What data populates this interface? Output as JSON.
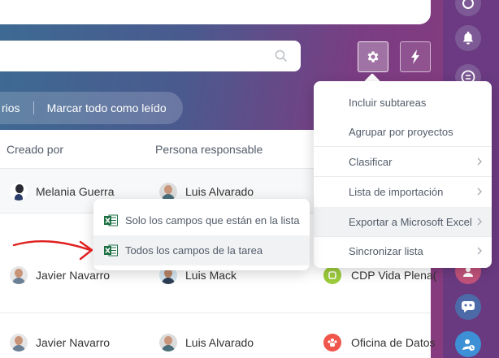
{
  "search": {
    "placeholder": ""
  },
  "toolbar": {
    "settings_icon": "gear-icon",
    "automation_icon": "lightning-icon"
  },
  "filters": {
    "left_fragment": "rios",
    "mark_all_read": "Marcar todo como leído"
  },
  "table": {
    "columns": [
      "Creado por",
      "Persona responsable"
    ],
    "rows": [
      {
        "created_by": "Melania Guerra",
        "responsible": "Luis Alvarado",
        "group": ""
      },
      {
        "created_by": "Javier Navarro",
        "responsible": "Luis Mack",
        "group": "CDP Vida Plena("
      },
      {
        "created_by": "Javier Navarro",
        "responsible": "Luis Alvarado",
        "group": "Oficina de Datos"
      }
    ]
  },
  "settings_menu": {
    "items": [
      {
        "label": "Incluir subtareas",
        "has_submenu": false
      },
      {
        "label": "Agrupar por proyectos",
        "has_submenu": false
      },
      {
        "label": "Clasificar",
        "has_submenu": true
      },
      {
        "label": "Lista de importación",
        "has_submenu": true
      },
      {
        "label": "Exportar a Microsoft Excel",
        "has_submenu": true
      },
      {
        "label": "Sincronizar lista",
        "has_submenu": true
      }
    ]
  },
  "export_submenu": {
    "items": [
      {
        "label": "Solo los campos que están en la lista",
        "icon": "excel-icon"
      },
      {
        "label": "Todos los campos de la tarea",
        "icon": "excel-icon"
      }
    ]
  },
  "colors": {
    "accent_red": "#e02020",
    "excel_green": "#1d7044",
    "text": "#333333",
    "muted": "#525c69"
  }
}
